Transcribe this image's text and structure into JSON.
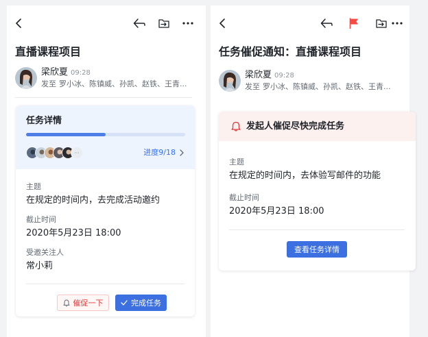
{
  "left": {
    "title": "直播课程项目",
    "sender": {
      "name": "梁欣夏",
      "time": "09:28",
      "recipients_label": "发至",
      "recipients": "罗小冰、陈镇威、孙凯、赵铁、王青..."
    },
    "task_card": {
      "heading": "任务详情",
      "progress": {
        "done": 9,
        "total": 18,
        "label": "进度9/18"
      },
      "subject_label": "主题",
      "subject": "在规定的时间内，去完成活动邀约",
      "deadline_label": "截止时间",
      "deadline": "2020年5月23日 18:00",
      "invitee_label": "受邀关注人",
      "invitee": "常小莉",
      "urge_button": "催促一下",
      "complete_button": "完成任务"
    }
  },
  "right": {
    "title": "任务催促通知：直播课程项目",
    "sender": {
      "name": "梁欣夏",
      "time": "09:28",
      "recipients_label": "发至",
      "recipients": "罗小冰、陈镇威、孙凯、赵铁、王青..."
    },
    "reminder_card": {
      "banner": "发起人催促尽快完成任务",
      "subject_label": "主题",
      "subject": "在规定的时间内，去体验写邮件的功能",
      "deadline_label": "截止时间",
      "deadline": "2020年5月23日 18:00",
      "view_button": "查看任务详情"
    }
  },
  "icons": {
    "back": "chevron-left-icon",
    "reply": "reply-icon",
    "flag": "flag-icon",
    "move": "move-to-folder-icon",
    "more": "more-horizontal-icon",
    "bell": "bell-icon",
    "check": "check-icon",
    "chevron_right": "chevron-right-icon"
  },
  "colors": {
    "accent": "#3c6fe0",
    "link": "#3370ff",
    "progress_fill": "#4e7fe6",
    "task_header_bg": "#eef4fd",
    "reminder_banner_bg": "#fdf1f0",
    "urge_red": "#e23c3c",
    "flag_red": "#f54a45",
    "page_bg": "#f2f3f5"
  }
}
